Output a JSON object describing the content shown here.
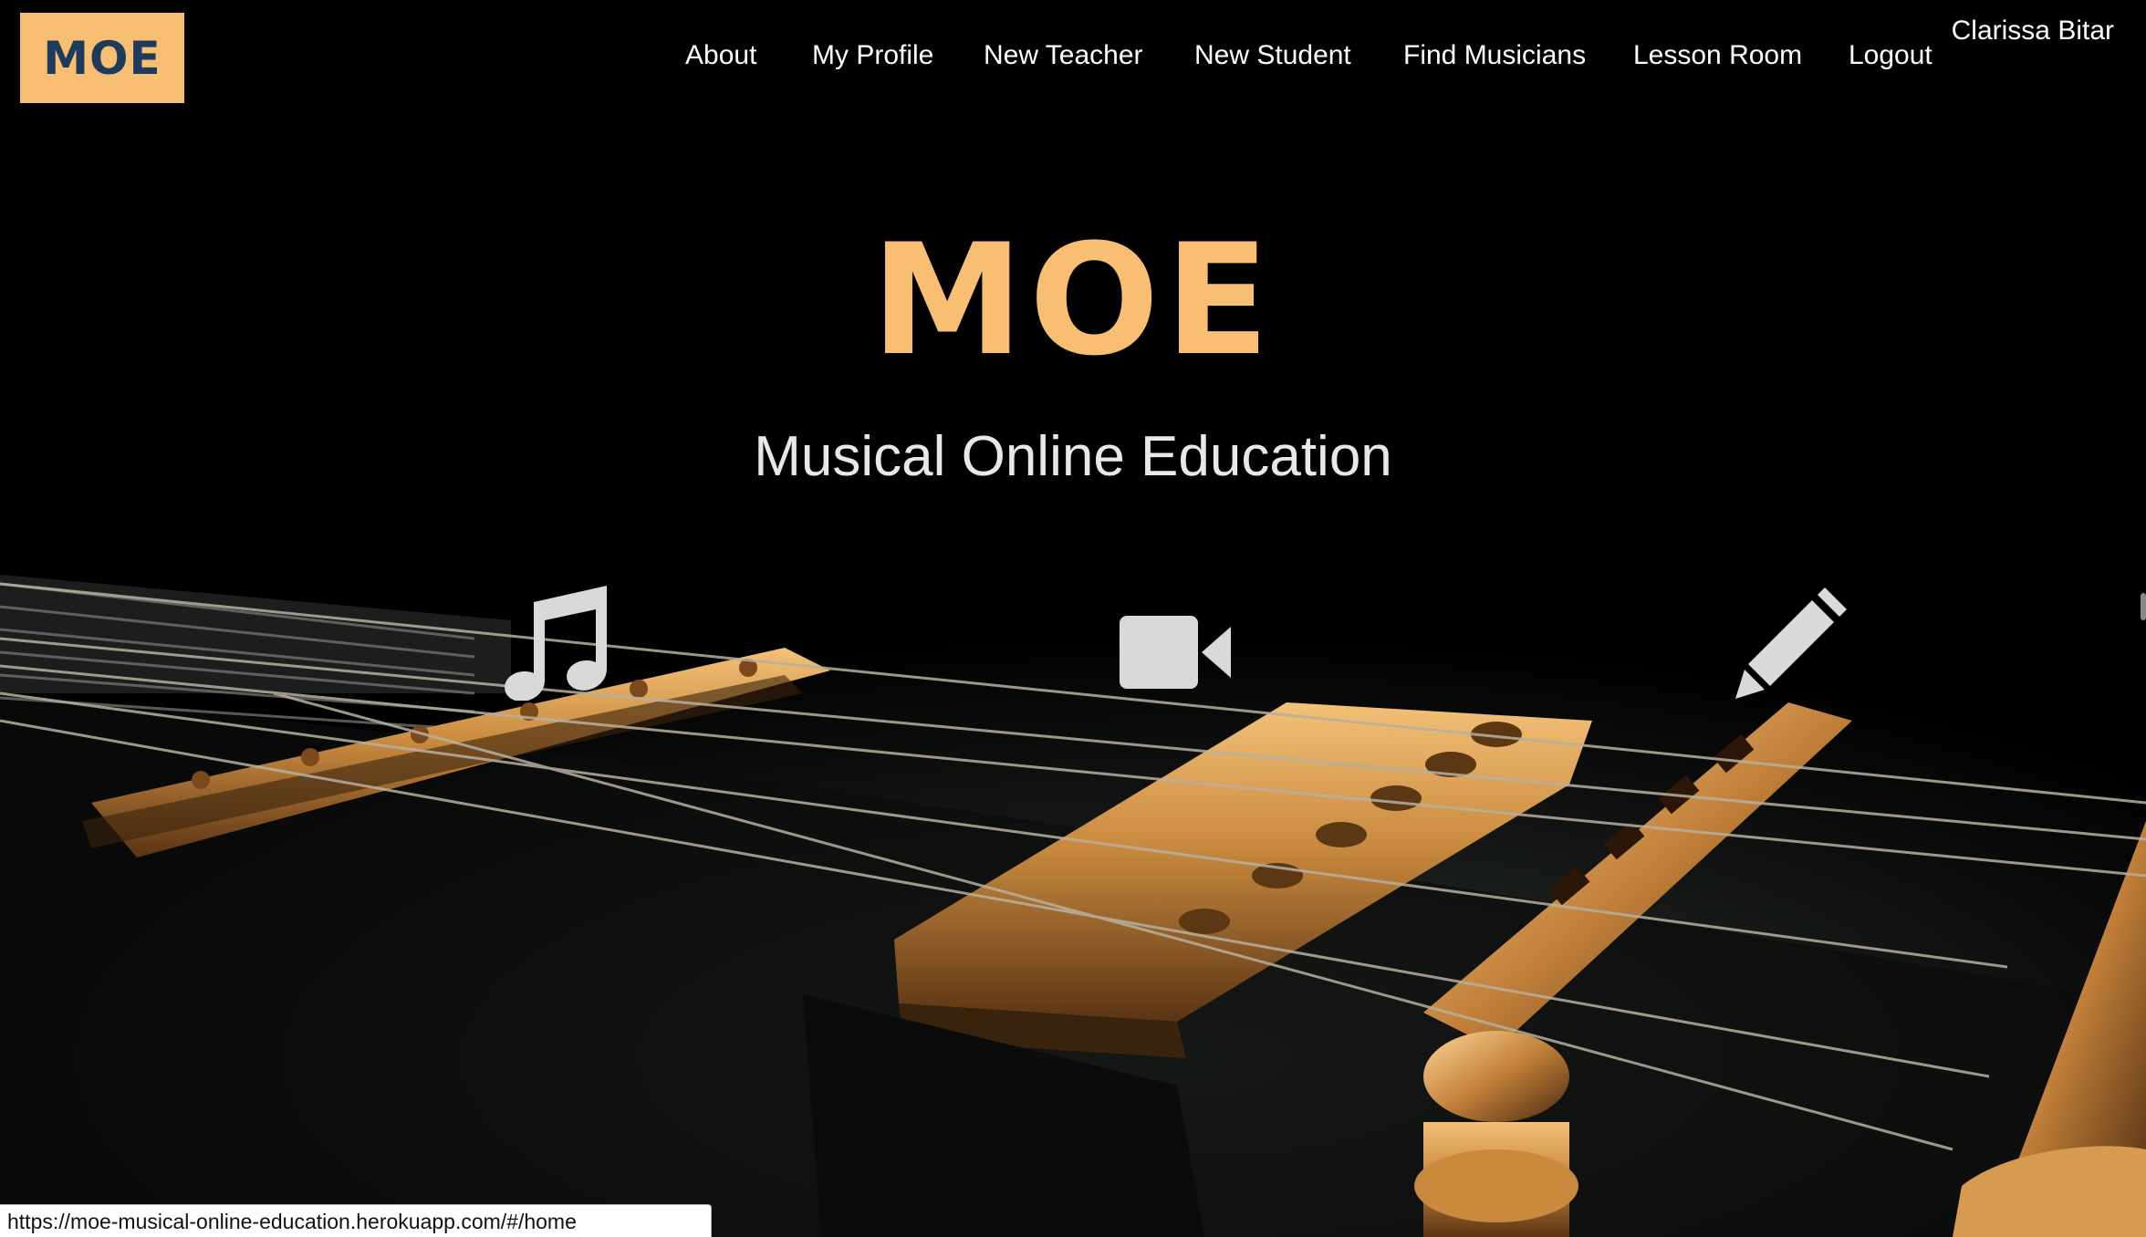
{
  "header": {
    "logo_text": "MOE",
    "nav": [
      {
        "label": "About"
      },
      {
        "label": "My Profile"
      },
      {
        "label": "New Teacher"
      },
      {
        "label": "New Student"
      },
      {
        "label": "Find Musicians"
      },
      {
        "label": "Lesson Room"
      },
      {
        "label": "Logout"
      }
    ],
    "user_name": "Clarissa Bitar"
  },
  "hero": {
    "title": "MOE",
    "subtitle": "Musical Online Education",
    "icons": [
      "music-note-icon",
      "video-camera-icon",
      "pencil-icon"
    ]
  },
  "status_bar": {
    "url": "https://moe-musical-online-education.herokuapp.com/#/home"
  },
  "colors": {
    "brand": "#f8be72",
    "logo_text": "#1f3b5c",
    "background": "#000000",
    "icon": "#d9d9d9"
  }
}
